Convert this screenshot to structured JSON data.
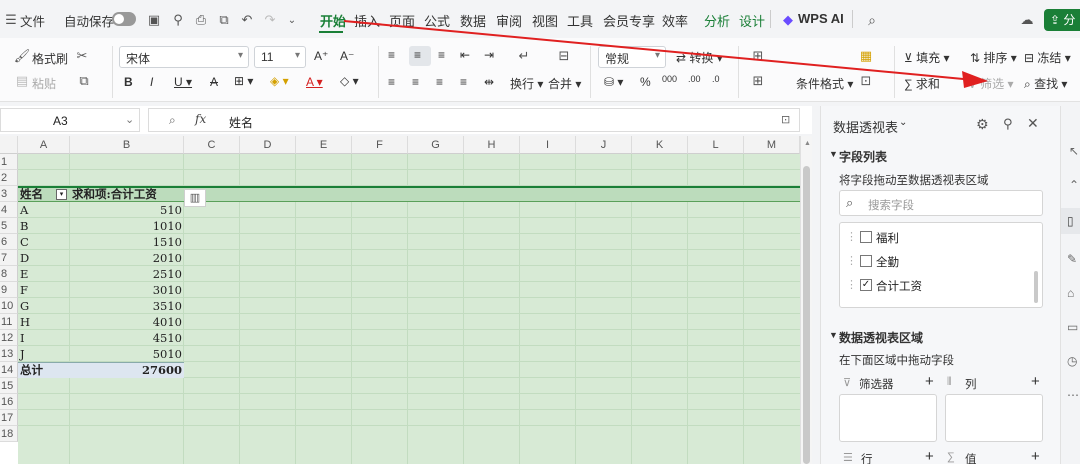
{
  "topbar": {
    "menu_label": "文件",
    "autosave_label": "自动保存",
    "tabs": [
      "开始",
      "插入",
      "页面",
      "公式",
      "数据",
      "审阅",
      "视图",
      "工具",
      "会员专享",
      "效率",
      "分析",
      "设计"
    ],
    "wps_ai_label": "WPS AI",
    "share_label": "分"
  },
  "ribbon": {
    "format_painter": "格式刷",
    "paste": "粘贴",
    "font_name": "宋体",
    "font_size": "11",
    "number_format": "常规",
    "convert": "转换",
    "wrap": "换行",
    "merge": "合并",
    "conditional_format": "条件格式",
    "fill": "填充",
    "sort": "排序",
    "freeze": "冻结",
    "sum": "求和",
    "filter": "筛选",
    "find": "查找"
  },
  "formula_bar": {
    "cell_ref": "A3",
    "fx": "fx",
    "content": "姓名"
  },
  "sheet": {
    "columns": [
      "A",
      "B",
      "C",
      "D",
      "E",
      "F",
      "G",
      "H",
      "I",
      "J",
      "K",
      "L",
      "M"
    ],
    "rows": [
      "1",
      "2",
      "3",
      "4",
      "5",
      "6",
      "7",
      "8",
      "9",
      "10",
      "11",
      "12",
      "13",
      "14",
      "15",
      "16",
      "17",
      "18"
    ],
    "pivot_header": {
      "name": "姓名",
      "sum": "求和项:合计工资"
    },
    "pivot_rows": [
      {
        "name": "A",
        "value": "510"
      },
      {
        "name": "B",
        "value": "1010"
      },
      {
        "name": "C",
        "value": "1510"
      },
      {
        "name": "D",
        "value": "2010"
      },
      {
        "name": "E",
        "value": "2510"
      },
      {
        "name": "F",
        "value": "3010"
      },
      {
        "name": "G",
        "value": "3510"
      },
      {
        "name": "H",
        "value": "4010"
      },
      {
        "name": "I",
        "value": "4510"
      },
      {
        "name": "J",
        "value": "5010"
      }
    ],
    "total": {
      "label": "总计",
      "value": "27600"
    }
  },
  "panel": {
    "title": "数据透视表",
    "field_list_title": "字段列表",
    "field_list_hint": "将字段拖动至数据透视表区域",
    "search_placeholder": "搜索字段",
    "fields": [
      {
        "label": "福利",
        "checked": false
      },
      {
        "label": "全勤",
        "checked": false
      },
      {
        "label": "合计工资",
        "checked": true
      }
    ],
    "area_title": "数据透视表区域",
    "area_hint": "在下面区域中拖动字段",
    "filter_label": "筛选器",
    "column_label": "列",
    "row_label": "行",
    "value_label": "值"
  },
  "colors": {
    "accent": "#1a7f37",
    "pivot_fill": "#cfe6cd",
    "arrow": "#e02020"
  }
}
